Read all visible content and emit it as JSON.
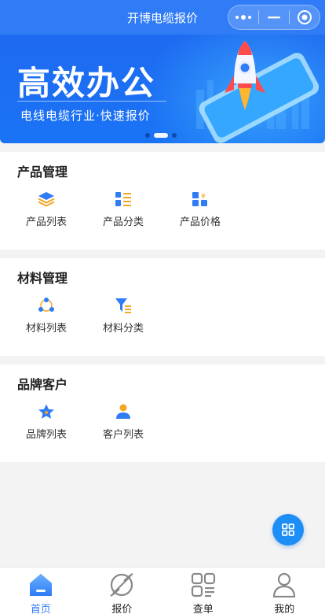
{
  "header": {
    "title": "开博电缆报价"
  },
  "banner": {
    "headline": "高效办公",
    "subline": "电线电缆行业·快速报价",
    "slide_count": 3,
    "active_slide": 2
  },
  "sections": [
    {
      "title": "产品管理",
      "items": [
        {
          "label": "产品列表",
          "icon": "layers-icon"
        },
        {
          "label": "产品分类",
          "icon": "category-list-icon"
        },
        {
          "label": "产品价格",
          "icon": "price-grid-icon"
        }
      ]
    },
    {
      "title": "材料管理",
      "items": [
        {
          "label": "材料列表",
          "icon": "network-dots-icon"
        },
        {
          "label": "材料分类",
          "icon": "filter-icon"
        }
      ]
    },
    {
      "title": "品牌客户",
      "items": [
        {
          "label": "品牌列表",
          "icon": "star-icon"
        },
        {
          "label": "客户列表",
          "icon": "user-icon"
        }
      ]
    }
  ],
  "tabbar": {
    "tabs": [
      {
        "label": "首页",
        "icon": "home-icon",
        "active": true
      },
      {
        "label": "报价",
        "icon": "planet-icon",
        "active": false
      },
      {
        "label": "查单",
        "icon": "grid-list-icon",
        "active": false
      },
      {
        "label": "我的",
        "icon": "person-icon",
        "active": false
      }
    ]
  },
  "colors": {
    "primary": "#2f7cf6",
    "accent_orange": "#f5a623",
    "fab": "#1d8ef5"
  }
}
